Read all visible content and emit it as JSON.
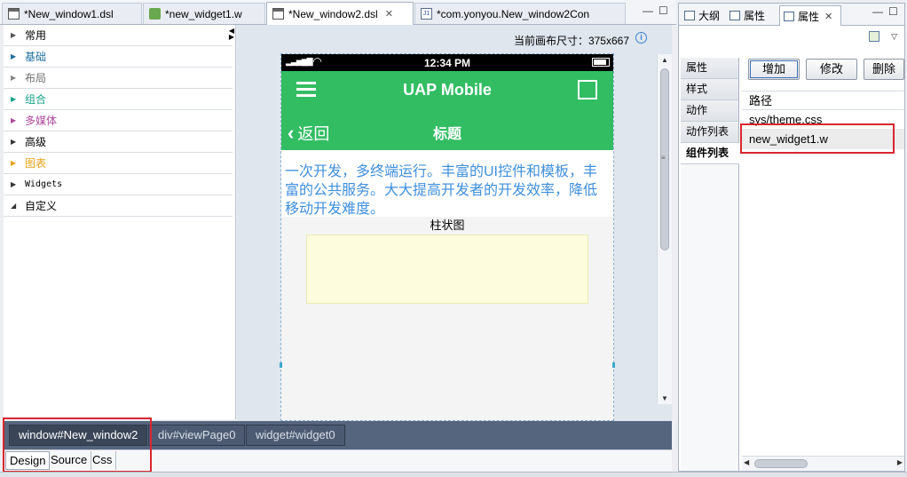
{
  "editor_tabs": [
    {
      "label": "*New_window1.dsl",
      "icon": "dsl-file-icon",
      "active": false,
      "closable": false
    },
    {
      "label": "*new_widget1.w",
      "icon": "widget-file-icon",
      "active": false,
      "closable": false
    },
    {
      "label": "*New_window2.dsl",
      "icon": "dsl-file-icon",
      "active": true,
      "closable": true
    },
    {
      "label": "*com.yonyou.New_window2Con",
      "icon": "java-file-icon",
      "active": false,
      "closable": false
    }
  ],
  "palette": {
    "items": [
      {
        "label": "常用",
        "color": "#000000",
        "expanded": false
      },
      {
        "label": "基础",
        "color": "#1d6f9c",
        "expanded": false
      },
      {
        "label": "布局",
        "color": "#707070",
        "expanded": false
      },
      {
        "label": "组合",
        "color": "#17a38a",
        "expanded": false
      },
      {
        "label": "多媒体",
        "color": "#b04a9d",
        "expanded": false
      },
      {
        "label": "高级",
        "color": "#000000",
        "expanded": false
      },
      {
        "label": "图表",
        "color": "#e8a21a",
        "expanded": false
      },
      {
        "label": "Widgets",
        "color": "#000000",
        "expanded": false
      },
      {
        "label": "自定义",
        "color": "#000000",
        "expanded": true
      }
    ]
  },
  "canvas": {
    "size_label": "当前画布尺寸：375x667",
    "phone": {
      "time": "12:34 PM",
      "app_title": "UAP Mobile",
      "back_label": "返回",
      "page_title": "标题",
      "intro_text": "一次开发，多终端运行。丰富的UI控件和模板，丰富的公共服务。大大提高开发者的开发效率，降低移动开发难度。",
      "chart_title": "柱状图"
    }
  },
  "breadcrumb": [
    "window#New_window2",
    "div#viewPage0",
    "widget#widget0"
  ],
  "view_tabs": [
    "Design",
    "Source",
    "Css"
  ],
  "right_panel": {
    "tabs": [
      {
        "label": "大纲",
        "active": false
      },
      {
        "label": "属性",
        "active": false
      },
      {
        "label": "属性",
        "active": true
      }
    ],
    "side_tabs": [
      "属性",
      "样式",
      "动作",
      "动作列表",
      "组件列表"
    ],
    "active_side_tab": "组件列表",
    "buttons": {
      "add": "增加",
      "edit": "修改",
      "delete": "删除"
    },
    "table": {
      "header": "路径",
      "rows": [
        "sys/theme.css",
        "new_widget1.w"
      ]
    }
  },
  "colors": {
    "app_green": "#33bd63",
    "intro_blue": "#3f8fdc",
    "highlight_red": "#d9262f",
    "breadcrumb_bar": "#56657e"
  }
}
